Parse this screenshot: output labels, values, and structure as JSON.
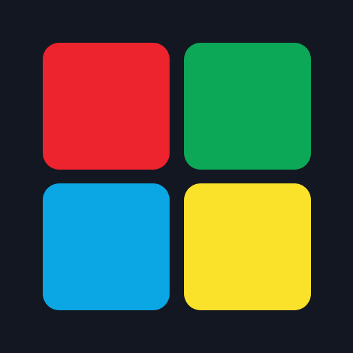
{
  "background": "#131722",
  "pads": [
    {
      "id": "red",
      "color": "#ED232D"
    },
    {
      "id": "green",
      "color": "#0CA858"
    },
    {
      "id": "blue",
      "color": "#0BA6E4"
    },
    {
      "id": "yellow",
      "color": "#FAE12A"
    }
  ]
}
